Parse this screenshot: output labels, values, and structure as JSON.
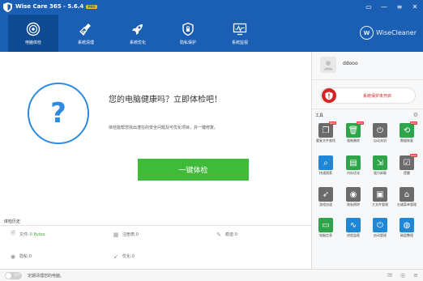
{
  "window": {
    "title": "Wise Care 365 - 5.6.4",
    "badge": "PRO",
    "icons": [
      "minimize-icon",
      "maximize-icon",
      "settings-icon",
      "close-icon"
    ]
  },
  "nav": {
    "tabs": [
      {
        "label": "电脑体检",
        "icon": "health-check-icon",
        "active": true
      },
      {
        "label": "系统清理",
        "icon": "broom-icon",
        "active": false
      },
      {
        "label": "系统优化",
        "icon": "rocket-icon",
        "active": false
      },
      {
        "label": "隐私保护",
        "icon": "shield-icon",
        "active": false
      },
      {
        "label": "系统监视",
        "icon": "monitor-icon",
        "active": false
      }
    ],
    "brand": "WiseCleaner",
    "brand_letter": "W"
  },
  "main": {
    "question_mark": "?",
    "headline": "您的电脑健康吗？立即体检吧！",
    "subtext": "体检能帮您找出潜在的安全问题及可优化项目，并一键修复。",
    "check_button": "一键体检"
  },
  "history": {
    "label": "体检历史",
    "items": [
      {
        "label": "文件: ",
        "value": "0 Bytes",
        "icon": "file-icon"
      },
      {
        "label": "注册表: ",
        "value": "0",
        "icon": "registry-icon"
      },
      {
        "label": "痕迹: ",
        "value": "0",
        "icon": "broom-small-icon"
      },
      {
        "label": "隐私: ",
        "value": "0",
        "icon": "eye-icon"
      },
      {
        "label": "优化: ",
        "value": "0",
        "icon": "rocket-small-icon"
      }
    ]
  },
  "footer": {
    "toggle_label": "OFF",
    "note": "定期清理您的电脑。",
    "icons": [
      "mail-icon",
      "globe-icon",
      "menu-icon"
    ]
  },
  "sidebar": {
    "username": "ddooo",
    "protection_text": "系统保护未开启",
    "tools_label": "工具",
    "tools": [
      {
        "label": "重复文件查找",
        "icon": "duplicate-icon",
        "color": "#6b6b6b",
        "new": true
      },
      {
        "label": "强制删除",
        "icon": "trash-icon",
        "color": "#2fa44a",
        "new": true
      },
      {
        "label": "自动关机",
        "icon": "power-icon",
        "color": "#6b6b6b",
        "new": false
      },
      {
        "label": "数据恢复",
        "icon": "recover-icon",
        "color": "#2fa44a",
        "new": true
      },
      {
        "label": "快速搜索",
        "icon": "search-icon",
        "color": "#1f87d6",
        "new": false
      },
      {
        "label": "内存优化",
        "icon": "memory-icon",
        "color": "#2fa44a",
        "new": false
      },
      {
        "label": "强力卸载",
        "icon": "uninstall-icon",
        "color": "#2fa44a",
        "new": false
      },
      {
        "label": "提醒",
        "icon": "reminder-icon",
        "color": "#6b6b6b",
        "new": true
      },
      {
        "label": "游戏加速",
        "icon": "rocket-tool-icon",
        "color": "#6b6b6b",
        "new": false
      },
      {
        "label": "隐私擦除",
        "icon": "privacy-icon",
        "color": "#6b6b6b",
        "new": false
      },
      {
        "label": "大文件管理",
        "icon": "folder-icon",
        "color": "#6b6b6b",
        "new": false
      },
      {
        "label": "右键菜单管理",
        "icon": "mouse-icon",
        "color": "#6b6b6b",
        "new": false
      },
      {
        "label": "电脑信息",
        "icon": "pc-info-icon",
        "color": "#2fa44a",
        "new": false
      },
      {
        "label": "进程监视",
        "icon": "process-icon",
        "color": "#1f87d6",
        "new": false
      },
      {
        "label": "启动管理",
        "icon": "startup-icon",
        "color": "#1f87d6",
        "new": false
      },
      {
        "label": "磁盘整理",
        "icon": "disk-icon",
        "color": "#1f87d6",
        "new": false
      }
    ],
    "new_badge": "NEW"
  }
}
